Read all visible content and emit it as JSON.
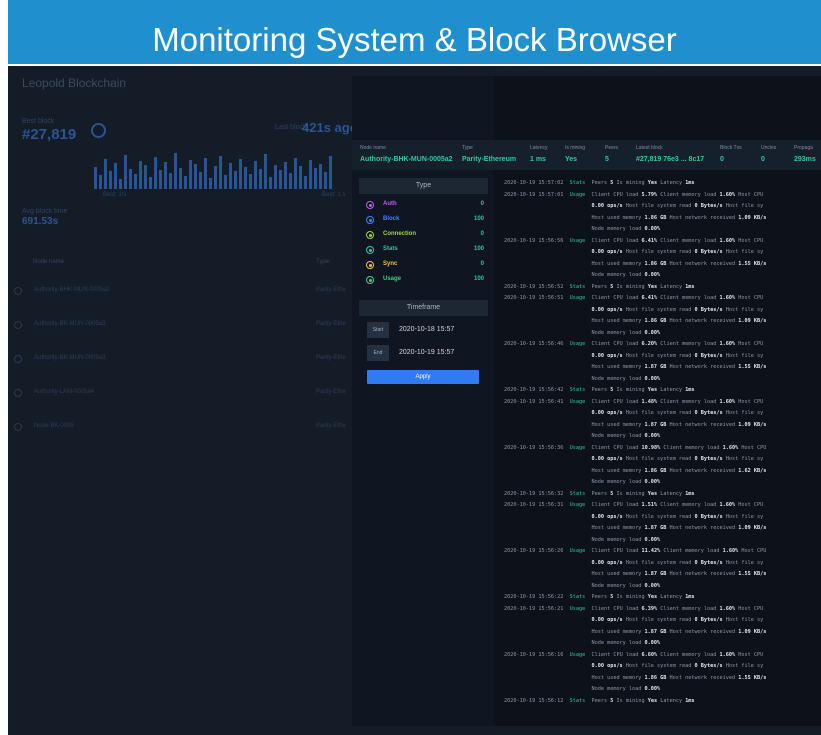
{
  "banner": {
    "title": "Monitoring System & Block Browser"
  },
  "background": {
    "app_title": "Leopold Blockchain",
    "best_block_label": "Best block",
    "best_block_value": "#27,819",
    "last_block_label": "Last block",
    "last_block_value": "421s ago",
    "chart_axis_left": "Best: 1/s",
    "chart_axis_right": "Best: 1.s",
    "avg_block_label": "Avg block time",
    "avg_block_value": "691.53s",
    "table_header_name": "Node name",
    "table_header_type": "Type",
    "rows": [
      {
        "name": "Authority-BHK-MUN-0005a2",
        "type": "Parity-Ethe"
      },
      {
        "name": "Authority-BK-MUN-0005a3",
        "type": "Parity-Ethe"
      },
      {
        "name": "Authority-BK-MUN-0005a3",
        "type": "Parity-Ethe"
      },
      {
        "name": "Authority-LAM-0005a4",
        "type": "Parity-Ethe"
      },
      {
        "name": "Node-BK-0005",
        "type": "Parity-Ethe"
      }
    ]
  },
  "node_header": {
    "labels": [
      "Node name",
      "Type",
      "Latency",
      "Is mining",
      "Peers",
      "Latest block",
      "Block Txs",
      "Uncles",
      "Propaga"
    ],
    "values": [
      "Authority-BHK-MUN-0005a2",
      "Parity-Ethereum",
      "1 ms",
      "Yes",
      "5",
      "#27,819 76e3 ... 8c17",
      "0",
      "0",
      "293ms"
    ]
  },
  "filter": {
    "type_title": "Type",
    "types": [
      {
        "label": "Auth",
        "count": "0",
        "color": "#c45bf2"
      },
      {
        "label": "Block",
        "count": "100",
        "color": "#3a86ff"
      },
      {
        "label": "Connection",
        "count": "0",
        "color": "#9fd33a"
      },
      {
        "label": "Stats",
        "count": "100",
        "color": "#2ec99e"
      },
      {
        "label": "Sync",
        "count": "0",
        "color": "#f2c23a"
      },
      {
        "label": "Usage",
        "count": "100",
        "color": "#3ad07f"
      }
    ],
    "timeframe_title": "Timeframe",
    "start_label": "Start",
    "start_value": "2020-10-18 15:57",
    "end_label": "End",
    "end_value": "2020-10-19 15:57",
    "apply_label": "Apply"
  },
  "log": [
    {
      "ts": "2020-10-19 15:57:02",
      "kind": "Stats",
      "lines": [
        [
          "Peers ",
          "5",
          " Is mining ",
          "Yes",
          " Latency ",
          "1ms"
        ]
      ]
    },
    {
      "ts": "2020-10-19 15:57:01",
      "kind": "Usage",
      "lines": [
        [
          "Client CPU load ",
          "5.79%",
          " Client memory load ",
          "1.60%",
          " Host CPU"
        ],
        [
          "",
          "0.00 ops/s",
          " Host file system read ",
          "0 Bytes/s",
          " Host file sy"
        ],
        [
          "Host used memory ",
          "1.86 GB",
          " Host network received ",
          "1.09 KB/s"
        ],
        [
          "Node memory load ",
          "0.00%"
        ]
      ]
    },
    {
      "ts": "2020-10-19 15:56:56",
      "kind": "Usage",
      "lines": [
        [
          "Client CPU load ",
          "6.41%",
          " Client memory load ",
          "1.60%",
          " Host CPU"
        ],
        [
          "",
          "0.00 ops/s",
          " Host file system read ",
          "0 Bytes/s",
          " Host file sy"
        ],
        [
          "Host used memory ",
          "1.86 GB",
          " Host network received ",
          "1.55 KB/s"
        ],
        [
          "Node memory load ",
          "0.00%"
        ]
      ]
    },
    {
      "ts": "2020-10-19 15:56:52",
      "kind": "Stats",
      "lines": [
        [
          "Peers ",
          "5",
          " Is mining ",
          "Yes",
          " Latency ",
          "1ms"
        ]
      ]
    },
    {
      "ts": "2020-10-19 15:56:51",
      "kind": "Usage",
      "lines": [
        [
          "Client CPU load ",
          "6.41%",
          " Client memory load ",
          "1.60%",
          " Host CPU"
        ],
        [
          "",
          "0.00 ops/s",
          " Host file system read ",
          "0 Bytes/s",
          " Host file sy"
        ],
        [
          "Host used memory ",
          "1.86 GB",
          " Host network received ",
          "1.09 KB/s"
        ],
        [
          "Node memory load ",
          "0.00%"
        ]
      ]
    },
    {
      "ts": "2020-10-19 15:56:46",
      "kind": "Usage",
      "lines": [
        [
          "Client CPU load ",
          "6.20%",
          " Client memory load ",
          "1.60%",
          " Host CPU"
        ],
        [
          "",
          "0.00 ops/s",
          " Host file system read ",
          "0 Bytes/s",
          " Host file sy"
        ],
        [
          "Host used memory ",
          "1.87 GB",
          " Host network received ",
          "1.55 KB/s"
        ],
        [
          "Node memory load ",
          "0.00%"
        ]
      ]
    },
    {
      "ts": "2020-10-19 15:56:42",
      "kind": "Stats",
      "lines": [
        [
          "Peers ",
          "5",
          " Is mining ",
          "Yes",
          " Latency ",
          "1ms"
        ]
      ]
    },
    {
      "ts": "2020-10-19 15:56:41",
      "kind": "Usage",
      "lines": [
        [
          "Client CPU load ",
          "1.48%",
          " Client memory load ",
          "1.60%",
          " Host CPU"
        ],
        [
          "",
          "0.00 ops/s",
          " Host file system read ",
          "0 Bytes/s",
          " Host file sy"
        ],
        [
          "Host used memory ",
          "1.87 GB",
          " Host network received ",
          "1.09 KB/s"
        ],
        [
          "Node memory load ",
          "0.00%"
        ]
      ]
    },
    {
      "ts": "2020-10-19 15:56:36",
      "kind": "Usage",
      "lines": [
        [
          "Client CPU load ",
          "10.98%",
          " Client memory load ",
          "1.60%",
          " Host CPU"
        ],
        [
          "",
          "0.00 ops/s",
          " Host file system read ",
          "0 Bytes/s",
          " Host file sy"
        ],
        [
          "Host used memory ",
          "1.86 GB",
          " Host network received ",
          "1.62 KB/s"
        ],
        [
          "Node memory load ",
          "0.00%"
        ]
      ]
    },
    {
      "ts": "2020-10-19 15:56:32",
      "kind": "Stats",
      "lines": [
        [
          "Peers ",
          "5",
          " Is mining ",
          "Yes",
          " Latency ",
          "1ms"
        ]
      ]
    },
    {
      "ts": "2020-10-19 15:56:31",
      "kind": "Usage",
      "lines": [
        [
          "Client CPU load ",
          "1.51%",
          " Client memory load ",
          "1.60%",
          " Host CPU"
        ],
        [
          "",
          "0.00 ops/s",
          " Host file system read ",
          "0 Bytes/s",
          " Host file sy"
        ],
        [
          "Host used memory ",
          "1.87 GB",
          " Host network received ",
          "1.09 KB/s"
        ],
        [
          "Node memory load ",
          "0.00%"
        ]
      ]
    },
    {
      "ts": "2020-10-19 15:56:26",
      "kind": "Usage",
      "lines": [
        [
          "Client CPU load ",
          "11.42%",
          " Client memory load ",
          "1.60%",
          " Host CPU"
        ],
        [
          "",
          "0.00 ops/s",
          " Host file system read ",
          "0 Bytes/s",
          " Host file sy"
        ],
        [
          "Host used memory ",
          "1.87 GB",
          " Host network received ",
          "1.55 KB/s"
        ],
        [
          "Node memory load ",
          "0.00%"
        ]
      ]
    },
    {
      "ts": "2020-10-19 15:56:22",
      "kind": "Stats",
      "lines": [
        [
          "Peers ",
          "5",
          " Is mining ",
          "Yes",
          " Latency ",
          "1ms"
        ]
      ]
    },
    {
      "ts": "2020-10-19 15:56:21",
      "kind": "Usage",
      "lines": [
        [
          "Client CPU load ",
          "6.39%",
          " Client memory load ",
          "1.60%",
          " Host CPU"
        ],
        [
          "",
          "0.00 ops/s",
          " Host file system read ",
          "0 Bytes/s",
          " Host file sy"
        ],
        [
          "Host used memory ",
          "1.87 GB",
          " Host network received ",
          "1.09 KB/s"
        ],
        [
          "Node memory load ",
          "0.00%"
        ]
      ]
    },
    {
      "ts": "2020-10-19 15:56:16",
      "kind": "Usage",
      "lines": [
        [
          "Client CPU load ",
          "6.60%",
          " Client memory load ",
          "1.60%",
          " Host CPU"
        ],
        [
          "",
          "0.00 ops/s",
          " Host file system read ",
          "0 Bytes/s",
          " Host file sy"
        ],
        [
          "Host used memory ",
          "1.86 GB",
          " Host network received ",
          "1.55 KB/s"
        ],
        [
          "Node memory load ",
          "0.00%"
        ]
      ]
    },
    {
      "ts": "2020-10-19 15:56:12",
      "kind": "Stats",
      "lines": [
        [
          "Peers ",
          "5",
          " Is mining ",
          "Yes",
          " Latency ",
          "1ms"
        ]
      ]
    }
  ]
}
